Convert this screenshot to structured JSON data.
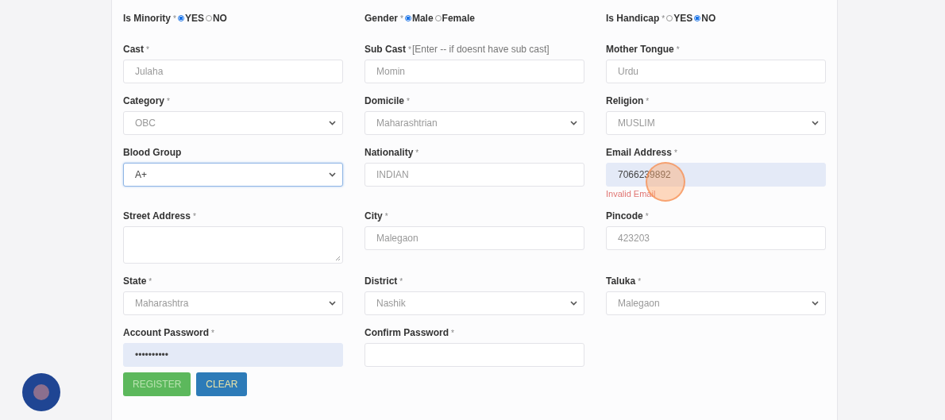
{
  "rows": [
    [
      {
        "kind": "radio",
        "label": "Is Minority",
        "mark": "*",
        "options": [
          {
            "label": "YES",
            "selected": true
          },
          {
            "label": "NO",
            "selected": false
          }
        ]
      },
      {
        "kind": "radio",
        "label": "Gender",
        "mark": "*",
        "options": [
          {
            "label": "Male",
            "selected": true
          },
          {
            "label": "Female",
            "selected": false
          }
        ]
      },
      {
        "kind": "radio",
        "label": "Is Handicap",
        "mark": "*",
        "options": [
          {
            "label": "YES",
            "selected": false
          },
          {
            "label": "NO",
            "selected": true
          }
        ]
      }
    ],
    [
      {
        "kind": "input",
        "label": "Cast",
        "mark": "*",
        "value": "Julaha"
      },
      {
        "kind": "input",
        "label": "Sub Cast",
        "mark": "*",
        "note": "[Enter -- if doesnt have sub cast]",
        "value": "Momin"
      },
      {
        "kind": "input",
        "label": "Mother Tongue",
        "mark": "*",
        "value": "Urdu"
      }
    ],
    [
      {
        "kind": "select",
        "label": "Category",
        "mark": "*",
        "value": "OBC"
      },
      {
        "kind": "select",
        "label": "Domicile",
        "mark": "*",
        "value": "Maharashtrian"
      },
      {
        "kind": "select",
        "label": "Religion",
        "mark": "*",
        "value": "MUSLIM"
      }
    ],
    [
      {
        "kind": "select",
        "label": "Blood Group",
        "value": "A+",
        "focused": true
      },
      {
        "kind": "input",
        "label": "Nationality",
        "mark": "*",
        "value": "INDIAN"
      },
      {
        "kind": "input",
        "label": "Email Address",
        "mark": "*",
        "value": "7066239892",
        "autofilled": true,
        "error": "Invalid Email"
      }
    ],
    [
      {
        "kind": "textarea",
        "label": "Street Address",
        "mark": "*"
      },
      {
        "kind": "input",
        "label": "City",
        "mark": "*",
        "value": "Malegaon"
      },
      {
        "kind": "input",
        "label": "Pincode",
        "mark": "*",
        "value": "423203"
      }
    ],
    [
      {
        "kind": "select",
        "label": "State",
        "mark": "*",
        "value": "Maharashtra"
      },
      {
        "kind": "select",
        "label": "District",
        "mark": "*",
        "value": "Nashik"
      },
      {
        "kind": "select",
        "label": "Taluka",
        "mark": "*",
        "value": "Malegaon"
      }
    ],
    [
      {
        "kind": "password",
        "label": "Account Password",
        "mark": "*",
        "value": "••••••••••",
        "autofilled": true
      },
      {
        "kind": "password",
        "label": "Confirm Password",
        "mark": "*"
      }
    ]
  ],
  "buttons": [
    {
      "label": "REGISTER",
      "kind": "primary"
    },
    {
      "label": "CLEAR",
      "kind": "secondary"
    }
  ]
}
